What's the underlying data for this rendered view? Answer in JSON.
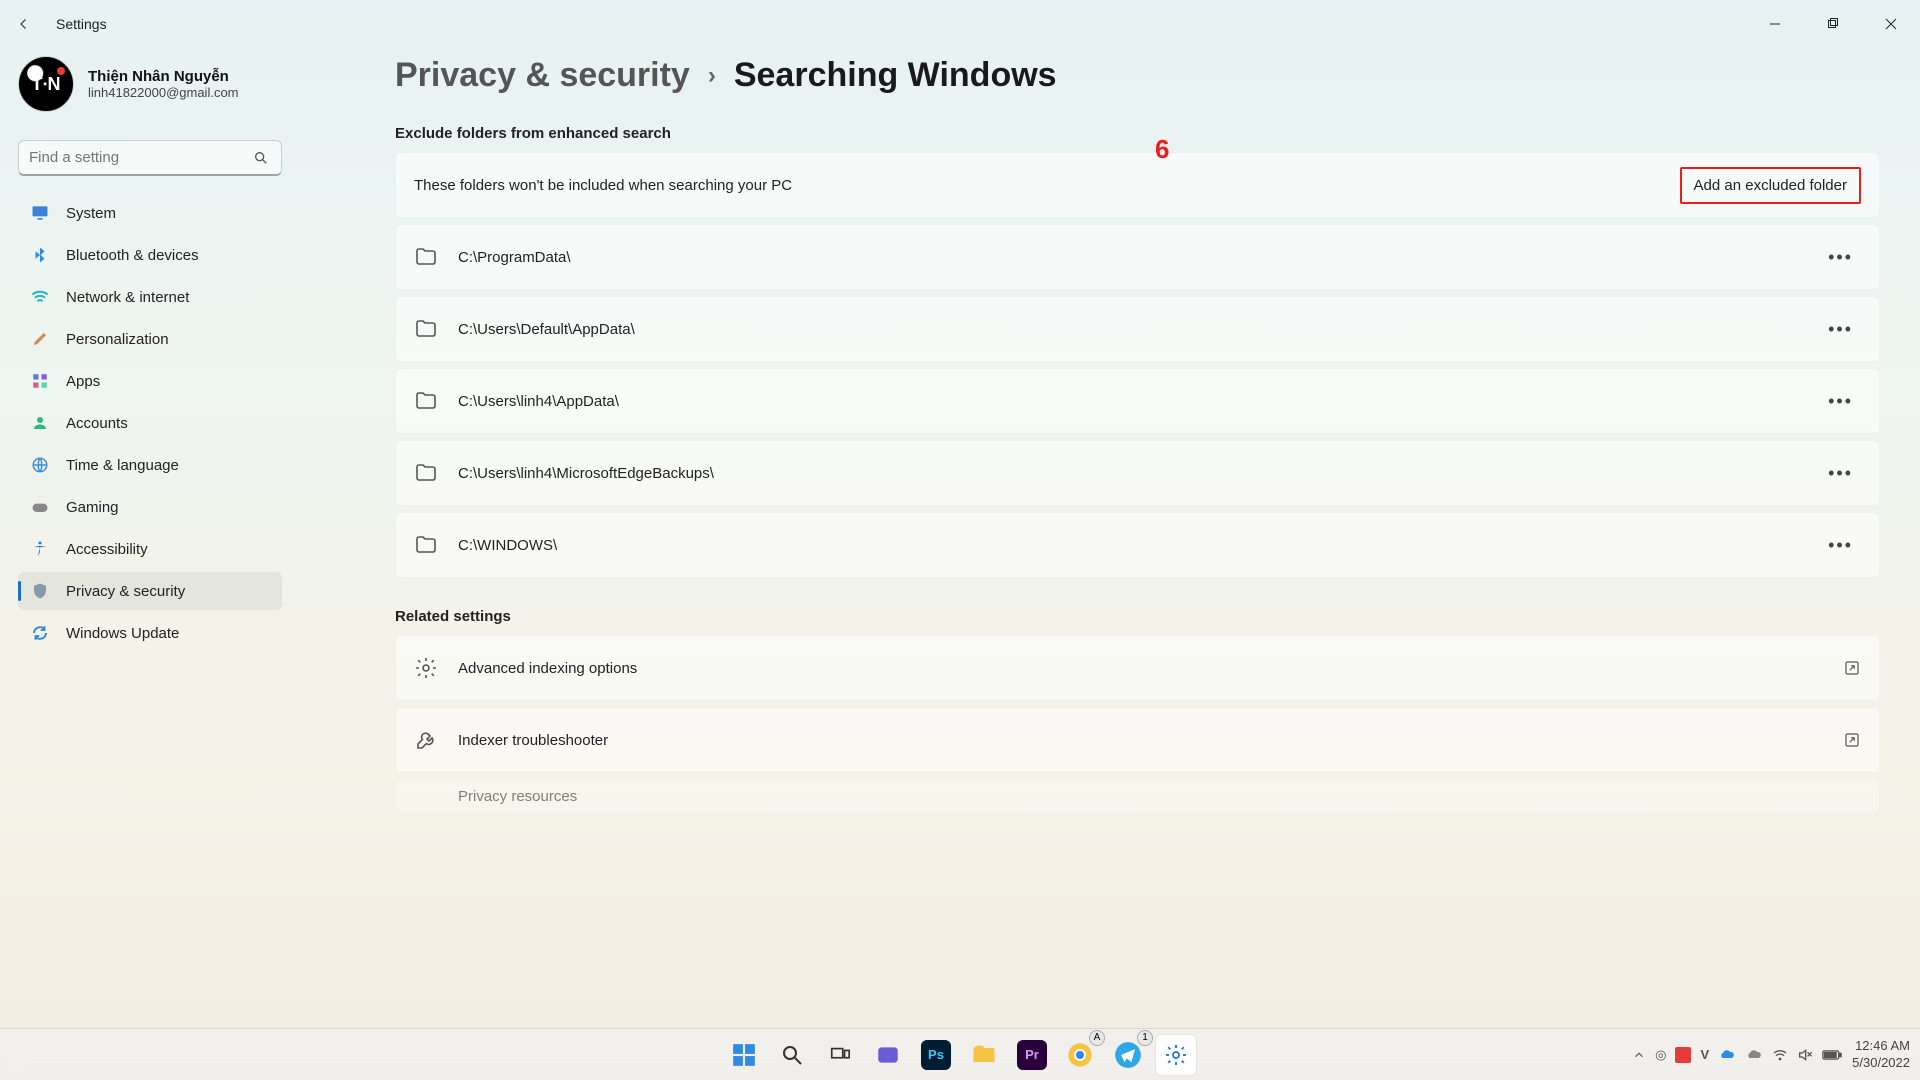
{
  "window": {
    "title": "Settings"
  },
  "user": {
    "name": "Thiện Nhân Nguyễn",
    "email": "linh41822000@gmail.com",
    "avatar_text": "T∙N"
  },
  "search": {
    "placeholder": "Find a setting"
  },
  "nav": {
    "items": [
      {
        "label": "System",
        "icon": "monitor",
        "selected": false
      },
      {
        "label": "Bluetooth & devices",
        "icon": "bluetooth",
        "selected": false
      },
      {
        "label": "Network & internet",
        "icon": "wifi",
        "selected": false
      },
      {
        "label": "Personalization",
        "icon": "brush",
        "selected": false
      },
      {
        "label": "Apps",
        "icon": "apps",
        "selected": false
      },
      {
        "label": "Accounts",
        "icon": "person",
        "selected": false
      },
      {
        "label": "Time & language",
        "icon": "globe",
        "selected": false
      },
      {
        "label": "Gaming",
        "icon": "gaming",
        "selected": false
      },
      {
        "label": "Accessibility",
        "icon": "accessibility",
        "selected": false
      },
      {
        "label": "Privacy & security",
        "icon": "shield",
        "selected": true
      },
      {
        "label": "Windows Update",
        "icon": "update",
        "selected": false
      }
    ]
  },
  "breadcrumb": {
    "parent": "Privacy & security",
    "current": "Searching Windows"
  },
  "sections": {
    "exclude": {
      "title": "Exclude folders from enhanced search",
      "description": "These folders won't be included when searching your PC",
      "button": "Add an excluded folder",
      "folders": [
        "C:\\ProgramData\\",
        "C:\\Users\\Default\\AppData\\",
        "C:\\Users\\linh4\\AppData\\",
        "C:\\Users\\linh4\\MicrosoftEdgeBackups\\",
        "C:\\WINDOWS\\"
      ]
    },
    "related": {
      "title": "Related settings",
      "items": [
        {
          "label": "Advanced indexing options",
          "icon": "gear"
        },
        {
          "label": "Indexer troubleshooter",
          "icon": "wrench"
        },
        {
          "label": "Privacy resources",
          "icon": "doc"
        }
      ]
    }
  },
  "annotation": {
    "marker": "6"
  },
  "taskbar": {
    "time": "12:46 AM",
    "date": "5/30/2022"
  }
}
